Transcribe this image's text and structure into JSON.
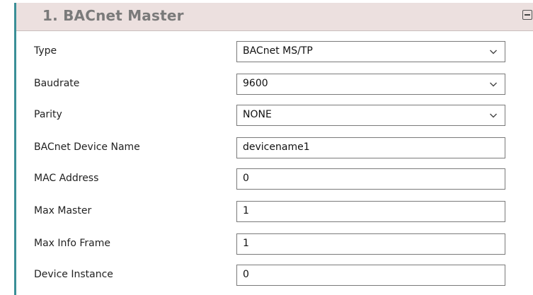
{
  "section": {
    "title": "1. BACnet Master"
  },
  "fields": [
    {
      "label": "Type",
      "value": "BACnet MS/TP",
      "control": "select"
    },
    {
      "label": "Baudrate",
      "value": "9600",
      "control": "select"
    },
    {
      "label": "Parity",
      "value": "NONE",
      "control": "select"
    },
    {
      "label": "BACnet Device Name",
      "value": "devicename1",
      "control": "text"
    },
    {
      "label": "MAC Address",
      "value": "0",
      "control": "text"
    },
    {
      "label": "Max Master",
      "value": "1",
      "control": "text"
    },
    {
      "label": "Max Info Frame",
      "value": "1",
      "control": "text"
    },
    {
      "label": "Device Instance",
      "value": "0",
      "control": "text"
    }
  ],
  "icons": {
    "collapse": "minus-square-icon",
    "dropdown": "chevron-down-icon"
  },
  "colors": {
    "header_bg": "#ece0df",
    "accent_border": "#3a8f97",
    "title_text": "#7a7a7a"
  }
}
